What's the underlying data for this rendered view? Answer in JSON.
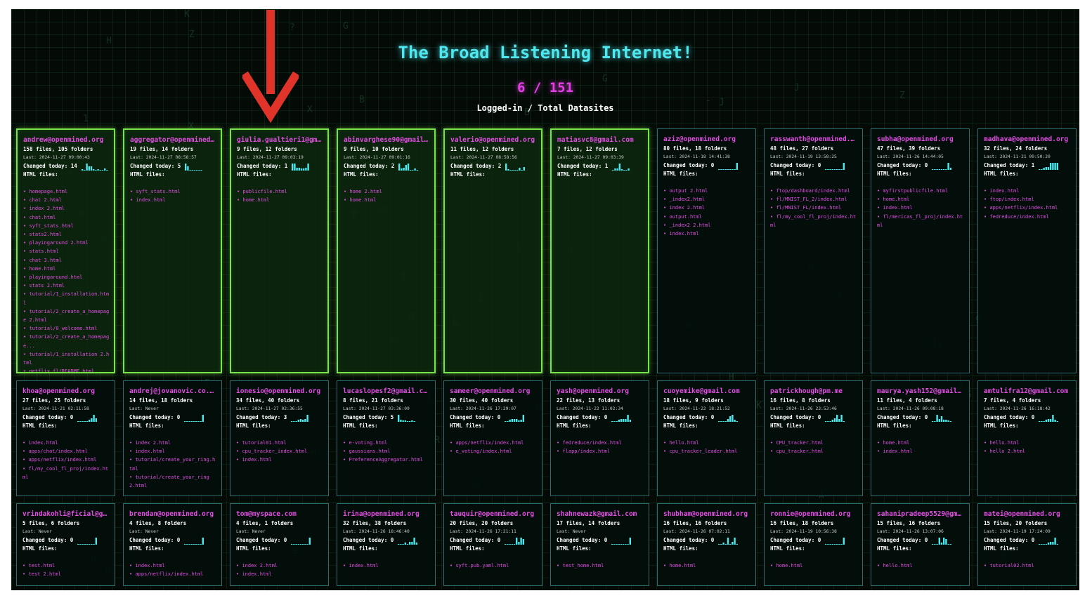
{
  "header": {
    "title": "The Broad Listening Internet!",
    "counter": "6 / 151",
    "subtitle": "Logged-in / Total Datasites"
  },
  "labels": {
    "files_suffix": "files",
    "folders_suffix": "folders",
    "last_prefix": "Last:",
    "changed_prefix": "Changed today:",
    "html_header": "HTML files:"
  },
  "colors": {
    "online_border": "#79e34a",
    "offline_border": "#2a6e70",
    "accent_cyan": "#4ee8ee",
    "accent_magenta": "#e34ee3",
    "arrow_red": "#e0342a"
  },
  "annotation": {
    "icon": "red-down-arrow-icon"
  },
  "datasites": [
    {
      "email": "andrew@openmined.org",
      "files": 158,
      "folders": 105,
      "last": "2024-11-27 09:00:43",
      "changed": 14,
      "online": true,
      "spark": [
        2,
        1,
        10,
        6,
        6,
        2,
        1,
        2,
        1,
        1,
        3,
        1
      ],
      "html_files": [
        "homepage.html",
        "chat 2.html",
        "index 2.html",
        "chat.html",
        "syft_stats.html",
        "stats2.html",
        "playingaround 2.html",
        "stats.html",
        "chat 3.html",
        "home.html",
        "playingaround.html",
        "stats 2.html",
        "tutorial/1_installation.html",
        "tutorial/2_create_a_homepage 2.html",
        "tutorial/0_welcome.html",
        "tutorial/2_create_a_homepage...",
        "tutorial/1_installation 2.html",
        "netflix_fl/README.html"
      ]
    },
    {
      "email": "aggregator@openmined.org",
      "files": 19,
      "folders": 14,
      "last": "2024-11-27 08:58:57",
      "changed": 5,
      "online": true,
      "spark": [
        10,
        6,
        1,
        1,
        1,
        1,
        1,
        1
      ],
      "html_files": [
        "syft_stats.html",
        "index.html"
      ]
    },
    {
      "email": "giulia.gualtieri1@gmail…",
      "files": 9,
      "folders": 12,
      "last": "2024-11-27 09:03:19",
      "changed": 1,
      "online": true,
      "spark": [
        10,
        10,
        4,
        4,
        3,
        3,
        4,
        10
      ],
      "html_files": [
        "publicfile.html",
        "home.html"
      ]
    },
    {
      "email": "abinvarghese90@gmail.com",
      "files": 9,
      "folders": 10,
      "last": "2024-11-27 09:01:16",
      "changed": 2,
      "online": true,
      "spark": [
        10,
        3,
        4,
        8,
        10,
        1,
        1,
        3,
        1
      ],
      "html_files": [
        "home 2.html",
        "home.html"
      ]
    },
    {
      "email": "valerio@openmined.org",
      "files": 11,
      "folders": 12,
      "last": "2024-11-27 08:58:56",
      "changed": 2,
      "online": true,
      "spark": [
        10,
        2,
        1,
        1,
        1,
        1,
        4,
        1,
        5
      ],
      "html_files": []
    },
    {
      "email": "matiasvc8@gmail.com",
      "files": 7,
      "folders": 12,
      "last": "2024-11-27 09:03:39",
      "changed": 1,
      "online": true,
      "spark": [
        1,
        3,
        3,
        10,
        2,
        1,
        1,
        3
      ],
      "html_files": []
    },
    {
      "email": "aziz@openmined.org",
      "files": 80,
      "folders": 18,
      "last": "2024-11-18 14:41:38",
      "changed": 0,
      "online": false,
      "spark": [
        1,
        1,
        1,
        1,
        1,
        1,
        1,
        1,
        10
      ],
      "html_files": [
        "output 2.html",
        "_index2.html",
        "index 2.html",
        "output.html",
        "_index2 2.html",
        "index.html"
      ]
    },
    {
      "email": "rasswanth@openmined.org",
      "files": 48,
      "folders": 27,
      "last": "2024-11-19 13:58:25",
      "changed": 0,
      "online": false,
      "spark": [
        1,
        1,
        1,
        1,
        1,
        1,
        1,
        1,
        10
      ],
      "html_files": [
        "ftop/dashboard/index.html",
        "fl/MNIST_FL_2/index.html",
        "fl/MNIST_FL/index.html",
        "fl/my_cool_fl_proj/index.html"
      ]
    },
    {
      "email": "subha@openmined.org",
      "files": 47,
      "folders": 39,
      "last": "2024-11-26 14:44:05",
      "changed": 0,
      "online": false,
      "spark": [
        1,
        1,
        1,
        1,
        1,
        1,
        1,
        10,
        3
      ],
      "html_files": [
        "myfirstpublicfile.html",
        "home.html",
        "index.html",
        "fl/mericas_fl_proj/index.html"
      ]
    },
    {
      "email": "madhava@openmined.org",
      "files": 32,
      "folders": 24,
      "last": "2024-11-21 09:50:20",
      "changed": 1,
      "online": false,
      "spark": [
        1,
        1,
        3,
        4,
        4,
        10,
        10,
        10,
        10
      ],
      "html_files": [
        "index.html",
        "ftop/index.html",
        "apps/netflix/index.html",
        "fedreduce/index.html"
      ]
    },
    {
      "email": "khoa@openmined.org",
      "files": 27,
      "folders": 25,
      "last": "2024-11-21 02:11:58",
      "changed": 0,
      "online": false,
      "spark": [
        1,
        1,
        1,
        1,
        1,
        3,
        5,
        10,
        5
      ],
      "html_files": [
        "index.html",
        "apps/chat/index.html",
        "apps/netflix/index.html",
        "fl/my_cool_fl_proj/index.html"
      ]
    },
    {
      "email": "andrej@jovanovic.co.za",
      "files": 14,
      "folders": 18,
      "last": "Never",
      "changed": 0,
      "online": false,
      "spark": [
        1,
        1,
        1,
        1,
        1,
        1,
        1,
        1,
        10
      ],
      "html_files": [
        "index 2.html",
        "index.html",
        "tutorial/create_your_ring.html",
        "tutorial/create_your_ring 2.html"
      ]
    },
    {
      "email": "ionesio@openmined.org",
      "files": 34,
      "folders": 40,
      "last": "2024-11-27 02:36:55",
      "changed": 3,
      "online": false,
      "spark": [
        1,
        1,
        1,
        3,
        4,
        3,
        4,
        10
      ],
      "html_files": [
        "tutorial01.html",
        "cpu_tracker_index.html",
        "index.html"
      ]
    },
    {
      "email": "lucaslopesf2@gmail.com",
      "files": 8,
      "folders": 21,
      "last": "2024-11-27 03:36:09",
      "changed": 5,
      "online": false,
      "spark": [
        10,
        3,
        2,
        2,
        1,
        1,
        2,
        1
      ],
      "html_files": [
        "e-voting.html",
        "gaussians.html",
        "PreferenceAggregator.html"
      ]
    },
    {
      "email": "sameer@openmined.org",
      "files": 30,
      "folders": 40,
      "last": "2024-11-26 17:29:07",
      "changed": 0,
      "online": false,
      "spark": [
        1,
        1,
        3,
        4,
        4,
        4,
        2,
        3,
        10
      ],
      "html_files": [
        "apps/netflix/index.html",
        "e_voting/index.html"
      ]
    },
    {
      "email": "yash@openmined.org",
      "files": 22,
      "folders": 13,
      "last": "2024-11-22 11:02:34",
      "changed": 0,
      "online": false,
      "spark": [
        1,
        1,
        1,
        3,
        4,
        4,
        4,
        10,
        3
      ],
      "html_files": [
        "fedreduce/index.html",
        "flapp/index.html"
      ]
    },
    {
      "email": "cuoyemike@gmail.com",
      "files": 18,
      "folders": 9,
      "last": "2024-11-22 18:21:52",
      "changed": 0,
      "online": false,
      "spark": [
        1,
        1,
        1,
        1,
        4,
        8,
        10,
        3,
        1
      ],
      "html_files": [
        "hello.html",
        "cpu_tracker_leader.html"
      ]
    },
    {
      "email": "patrickhough@pm.me",
      "files": 16,
      "folders": 8,
      "last": "2024-11-26 23:53:46",
      "changed": 0,
      "online": false,
      "spark": [
        1,
        1,
        1,
        3,
        5,
        10,
        4,
        10,
        1
      ],
      "html_files": [
        "CPU_tracker.html",
        "cpu_tracker.html"
      ]
    },
    {
      "email": "maurya.yash152@gmail.com",
      "files": 11,
      "folders": 4,
      "last": "2024-11-26 09:08:18",
      "changed": 0,
      "online": false,
      "spark": [
        1,
        1,
        10,
        4,
        8,
        3,
        3,
        2,
        1
      ],
      "html_files": [
        "home.html",
        "index.html"
      ]
    },
    {
      "email": "amtulifra12@gmail.com",
      "files": 7,
      "folders": 4,
      "last": "2024-11-26 16:18:42",
      "changed": 0,
      "online": false,
      "spark": [
        1,
        1,
        1,
        3,
        4,
        4,
        10,
        3,
        1
      ],
      "html_files": [
        "hello.html",
        "hello 2.html"
      ]
    },
    {
      "email": "vrindakohli@ficial@gmai…",
      "files": 5,
      "folders": 6,
      "last": "Never",
      "changed": 0,
      "online": false,
      "spark": [
        1,
        1,
        1,
        1,
        1,
        1,
        1,
        1,
        10
      ],
      "html_files": [
        "test.html",
        "test 2.html"
      ]
    },
    {
      "email": "brendan@openmined.org",
      "files": 4,
      "folders": 8,
      "last": "Never",
      "changed": 0,
      "online": false,
      "spark": [
        1,
        1,
        1,
        1,
        1,
        1,
        1,
        1,
        10
      ],
      "html_files": [
        "index.html",
        "apps/netflix/index.html"
      ]
    },
    {
      "email": "tom@myspace.com",
      "files": 4,
      "folders": 1,
      "last": "Never",
      "changed": 0,
      "online": false,
      "spark": [
        1,
        1,
        1,
        1,
        1,
        1,
        1,
        1,
        10
      ],
      "html_files": [
        "index 2.html",
        "index.html"
      ]
    },
    {
      "email": "irina@openmined.org",
      "files": 32,
      "folders": 38,
      "last": "2024-11-26 18:46:40",
      "changed": 0,
      "online": false,
      "spark": [
        1,
        1,
        1,
        3,
        1,
        4,
        4,
        10,
        3
      ],
      "html_files": [
        "index.html"
      ]
    },
    {
      "email": "tauquir@openmined.org",
      "files": 20,
      "folders": 20,
      "last": "2024-11-26 17:21:11",
      "changed": 0,
      "online": false,
      "spark": [
        1,
        1,
        1,
        1,
        1,
        10,
        4,
        10,
        8
      ],
      "html_files": [
        "syft.pub.yaml.html"
      ]
    },
    {
      "email": "shahnewazk@gmail.com",
      "files": 17,
      "folders": 14,
      "last": "Never",
      "changed": 0,
      "online": false,
      "spark": [
        1,
        1,
        1,
        1,
        1,
        1,
        1,
        1,
        10
      ],
      "html_files": [
        "test_home.html"
      ]
    },
    {
      "email": "shubham@openmined.org",
      "files": 16,
      "folders": 16,
      "last": "2024-11-26 07:02:11",
      "changed": 0,
      "online": false,
      "spark": [
        1,
        1,
        3,
        1,
        10,
        1,
        4,
        10,
        1
      ],
      "html_files": [
        "home.html"
      ]
    },
    {
      "email": "ronnie@openmined.org",
      "files": 16,
      "folders": 18,
      "last": "2024-11-19 10:56:38",
      "changed": 0,
      "online": false,
      "spark": [
        1,
        1,
        1,
        1,
        1,
        1,
        1,
        1,
        10
      ],
      "html_files": [
        "home.html"
      ]
    },
    {
      "email": "sahanipradeep5529@gmail…",
      "files": 15,
      "folders": 16,
      "last": "2024-11-26 13:07:06",
      "changed": 0,
      "online": false,
      "spark": [
        1,
        1,
        1,
        10,
        3,
        10,
        8,
        1,
        1
      ],
      "html_files": [
        "hello.html"
      ]
    },
    {
      "email": "matei@openmined.org",
      "files": 15,
      "folders": 20,
      "last": "2024-11-19 17:24:09",
      "changed": 0,
      "online": false,
      "spark": [
        1,
        1,
        1,
        1,
        3,
        4,
        4,
        10,
        1
      ],
      "html_files": [
        "tutorial02.html"
      ]
    }
  ]
}
